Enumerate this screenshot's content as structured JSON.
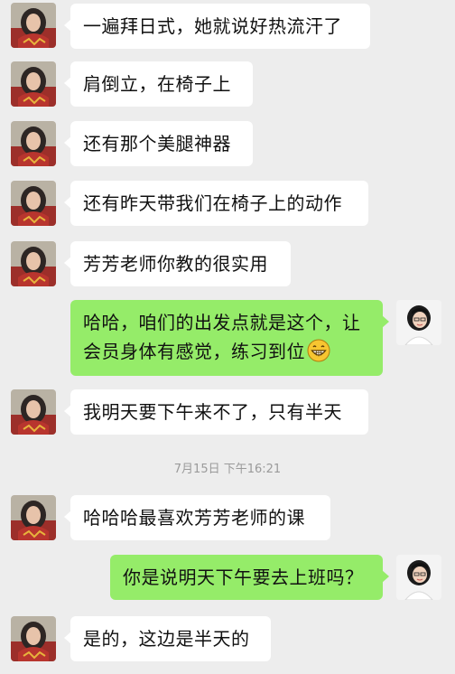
{
  "messages": [
    {
      "side": "in",
      "text": "一遍拜日式，她就说好热流汗了"
    },
    {
      "side": "in",
      "text": "肩倒立，在椅子上"
    },
    {
      "side": "in",
      "text": "还有那个美腿神器"
    },
    {
      "side": "in",
      "text": "还有昨天带我们在椅子上的动作"
    },
    {
      "side": "in",
      "text": "芳芳老师你教的很实用"
    },
    {
      "side": "out",
      "line1": "哈哈，咱们的出发点就是这个，让",
      "line2": "会员身体有感觉，练习到位",
      "emoji": "grinning-face-emoji"
    },
    {
      "side": "in",
      "text": "我明天要下午来不了，只有半天"
    },
    {
      "side": "in",
      "text": "哈哈哈最喜欢芳芳老师的课"
    },
    {
      "side": "out",
      "text": "你是说明天下午要去上班吗？"
    },
    {
      "side": "in",
      "text": "是的，这边是半天的"
    }
  ],
  "timestamp": "7月15日 下午16:21",
  "colors": {
    "background": "#ededed",
    "incoming_bubble": "#ffffff",
    "outgoing_bubble": "#95ec69",
    "timestamp_text": "#9a9a9a"
  }
}
